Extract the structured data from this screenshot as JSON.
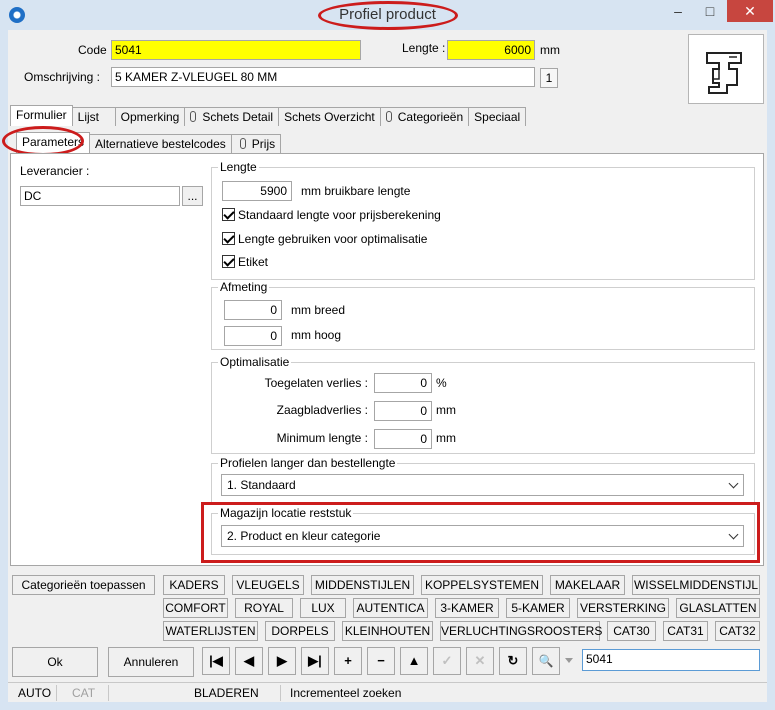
{
  "window": {
    "title": "Profiel product",
    "minimize": "–",
    "maximize": "□",
    "close": "✕"
  },
  "header": {
    "code_label": "Code :",
    "code_value": "5041",
    "lengte_label": "Lengte :",
    "lengte_value": "6000",
    "lengte_unit": "mm",
    "omschrijving_label": "Omschrijving :",
    "omschrijving_value": "5 KAMER Z-VLEUGEL 80 MM",
    "count_value": "1"
  },
  "tabs": {
    "main": [
      "Formulier",
      "Lijst",
      "Opmerking",
      "Schets Detail",
      "Schets Overzicht",
      "Categorieën",
      "Speciaal"
    ],
    "sub": [
      "Parameters",
      "Alternatieve bestelcodes",
      "Prijs"
    ]
  },
  "left": {
    "leverancier_label": "Leverancier :",
    "leverancier_value": "DC",
    "browse_label": "..."
  },
  "lengte_group": {
    "title": "Lengte",
    "value": "5900",
    "unit": "mm bruikbare lengte",
    "chk1": "Standaard lengte voor prijsberekening",
    "chk2": "Lengte gebruiken voor optimalisatie",
    "chk3": "Etiket"
  },
  "afmeting_group": {
    "title": "Afmeting",
    "breed_value": "0",
    "breed_unit": "mm breed",
    "hoog_value": "0",
    "hoog_unit": "mm hoog"
  },
  "optim_group": {
    "title": "Optimalisatie",
    "verlies_label": "Toegelaten verlies :",
    "verlies_value": "0",
    "verlies_unit": "%",
    "zaag_label": "Zaagbladverlies :",
    "zaag_value": "0",
    "zaag_unit": "mm",
    "min_label": "Minimum lengte :",
    "min_value": "0",
    "min_unit": "mm"
  },
  "profielen_group": {
    "title": "Profielen langer dan bestellengte",
    "selected": "1.  Standaard"
  },
  "magazijn_group": {
    "title": "Magazijn locatie reststuk",
    "selected": "2.  Product en kleur categorie"
  },
  "categories": {
    "apply_label": "Categorieën toepassen",
    "row1": [
      "KADERS",
      "VLEUGELS",
      "MIDDENSTIJLEN",
      "KOPPELSYSTEMEN",
      "MAKELAAR",
      "WISSELMIDDENSTIJL"
    ],
    "row2": [
      "COMFORT",
      "ROYAL",
      "LUX",
      "AUTENTICA",
      "3-KAMER",
      "5-KAMER",
      "VERSTERKING",
      "GLASLATTEN"
    ],
    "row3": [
      "WATERLIJSTEN",
      "DORPELS",
      "KLEINHOUTEN",
      "VERLUCHTINGSROOSTERS",
      "CAT30",
      "CAT31",
      "CAT32"
    ]
  },
  "footer": {
    "ok_label": "Ok",
    "cancel_label": "Annuleren",
    "nav": [
      "|◀",
      "◀",
      "▶",
      "▶|",
      "+",
      "−",
      "▲",
      "✓",
      "✕",
      "↻",
      "🔍"
    ],
    "search_value": "5041"
  },
  "status": {
    "mode": "AUTO",
    "cat": "CAT",
    "state": "BLADEREN",
    "hint": "Incrementeel zoeken"
  }
}
